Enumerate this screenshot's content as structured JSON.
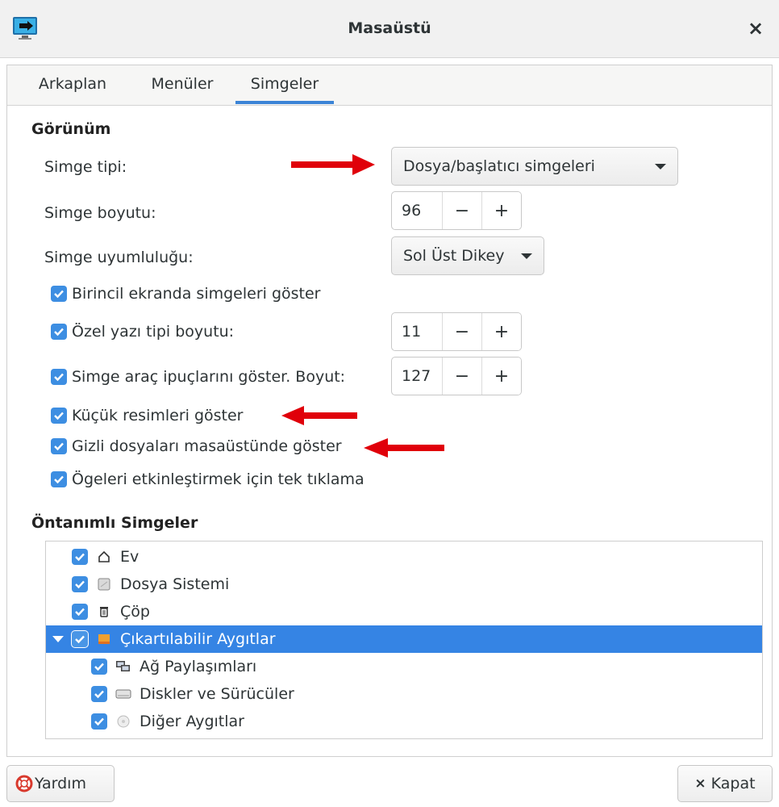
{
  "window": {
    "title": "Masaüstü",
    "close_glyph": "×"
  },
  "tabs": [
    {
      "label": "Arkaplan",
      "active": false
    },
    {
      "label": "Menüler",
      "active": false
    },
    {
      "label": "Simgeler",
      "active": true
    }
  ],
  "appearance": {
    "heading": "Görünüm",
    "icon_type": {
      "label": "Simge tipi:",
      "value": "Dosya/başlatıcı simgeleri"
    },
    "icon_size": {
      "label": "Simge boyutu:",
      "value": "96",
      "minus": "−",
      "plus": "+"
    },
    "icon_alignment": {
      "label": "Simge uyumluluğu:",
      "value": "Sol Üst Dikey"
    },
    "checks": {
      "primary_screen": {
        "label": "Birincil ekranda simgeleri göster",
        "checked": true
      },
      "custom_font": {
        "label": "Özel yazı tipi boyutu:",
        "checked": true,
        "value": "11"
      },
      "tooltips": {
        "label": "Simge araç ipuçlarını göster. Boyut:",
        "checked": true,
        "value": "127"
      },
      "thumbnails": {
        "label": "Küçük resimleri göster",
        "checked": true
      },
      "hidden_files": {
        "label": "Gizli dosyaları masaüstünde göster",
        "checked": true
      },
      "single_click": {
        "label": "Ögeleri etkinleştirmek için tek tıklama",
        "checked": true
      }
    }
  },
  "default_icons": {
    "heading": "Öntanımlı Simgeler",
    "items": [
      {
        "label": "Ev",
        "icon": "home-icon",
        "checked": true
      },
      {
        "label": "Dosya Sistemi",
        "icon": "drive-icon",
        "checked": true
      },
      {
        "label": "Çöp",
        "icon": "trash-icon",
        "checked": true
      },
      {
        "label": "Çıkartılabilir Aygıtlar",
        "icon": "removable-icon",
        "checked": true,
        "expanded": true,
        "selected": true
      },
      {
        "label": "Ağ Paylaşımları",
        "icon": "network-icon",
        "checked": true
      },
      {
        "label": "Diskler ve Sürücüler",
        "icon": "disk-icon",
        "checked": true
      },
      {
        "label": "Diğer Aygıtlar",
        "icon": "media-icon",
        "checked": true
      }
    ]
  },
  "footer": {
    "help": "Yardım",
    "close": "Kapat",
    "close_glyph": "×"
  },
  "colors": {
    "accent": "#3584e4",
    "annotation_arrow": "#e0000a"
  }
}
